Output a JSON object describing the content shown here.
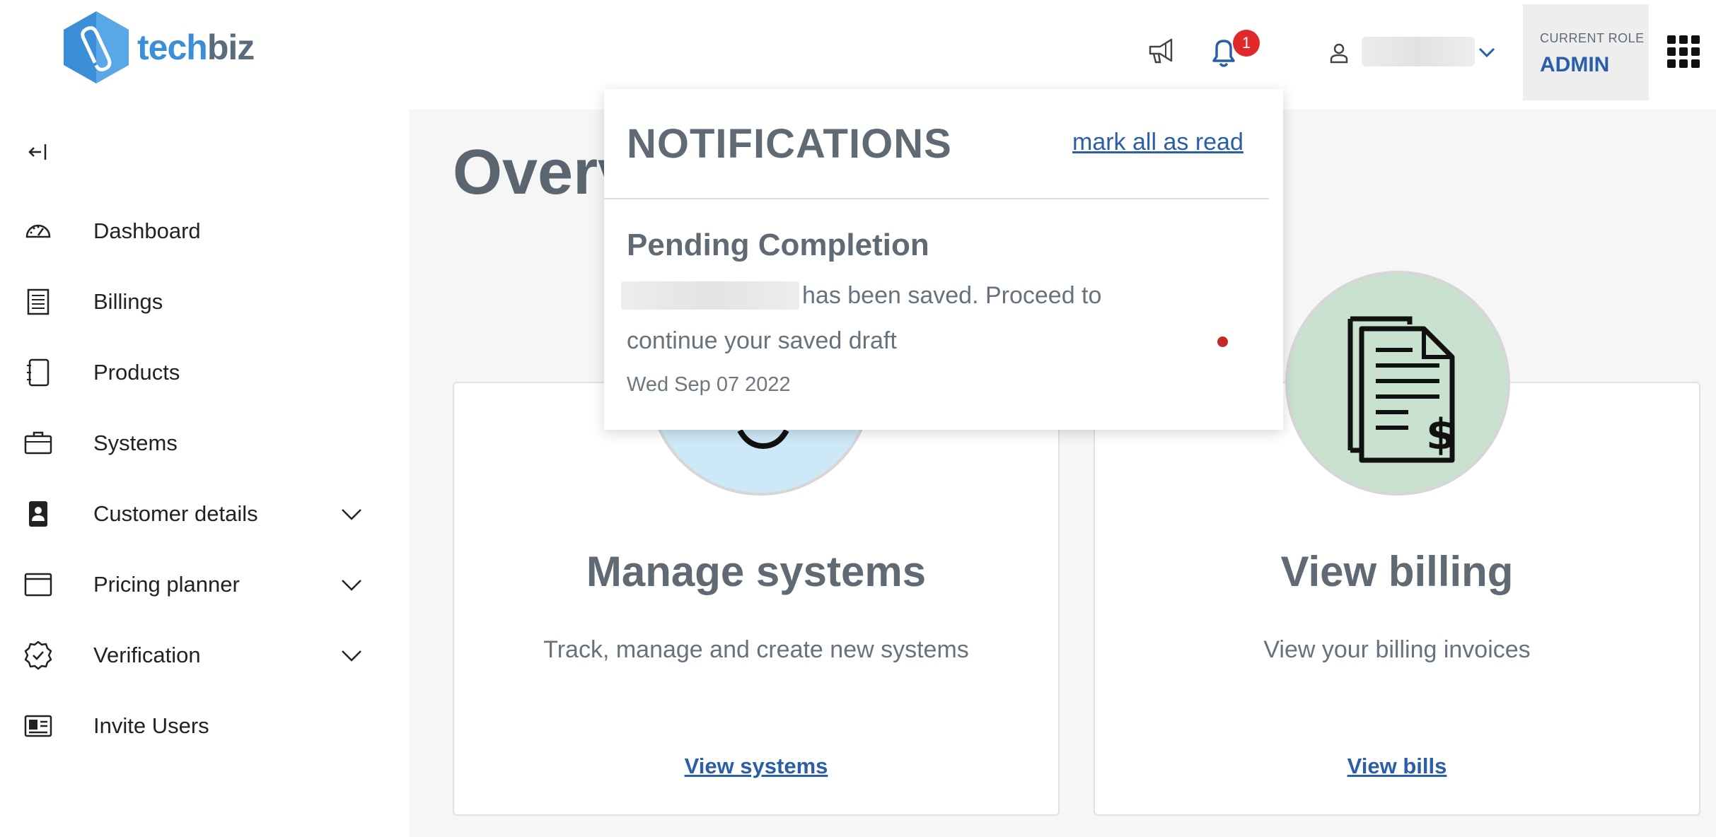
{
  "header": {
    "logo": {
      "part1": "tech",
      "part2": "biz"
    },
    "notifications_badge": "1",
    "role": {
      "label": "CURRENT ROLE",
      "value": "ADMIN"
    }
  },
  "sidebar": {
    "items": [
      {
        "label": "Dashboard",
        "icon": "gauge-icon",
        "expandable": false
      },
      {
        "label": "Billings",
        "icon": "receipt-icon",
        "expandable": false
      },
      {
        "label": "Products",
        "icon": "notebook-icon",
        "expandable": false
      },
      {
        "label": "Systems",
        "icon": "briefcase-icon",
        "expandable": false
      },
      {
        "label": "Customer details",
        "icon": "badge-icon",
        "expandable": true
      },
      {
        "label": "Pricing planner",
        "icon": "window-icon",
        "expandable": true
      },
      {
        "label": "Verification",
        "icon": "verified-icon",
        "expandable": true
      },
      {
        "label": "Invite Users",
        "icon": "id-card-icon",
        "expandable": false
      }
    ]
  },
  "main": {
    "title": "Overview",
    "cards": [
      {
        "title": "Manage systems",
        "description": "Track, manage and create new systems",
        "link": "View systems"
      },
      {
        "title": "View billing",
        "description": "View your billing invoices",
        "link": "View bills"
      }
    ]
  },
  "notifications": {
    "title": "NOTIFICATIONS",
    "mark_all": "mark all as read",
    "items": [
      {
        "title": "Pending Completion",
        "text_part1": "has been saved. Proceed to",
        "text_part2": "continue your saved draft",
        "date": "Wed Sep 07 2022",
        "unread": true
      }
    ]
  },
  "colors": {
    "accent": "#2a5ea8",
    "badge": "#e02a2a",
    "unread_dot": "#c62828",
    "title_gray": "#5f6a74",
    "circle_blue": "#cde8f7",
    "circle_green": "#c8e2cf"
  }
}
